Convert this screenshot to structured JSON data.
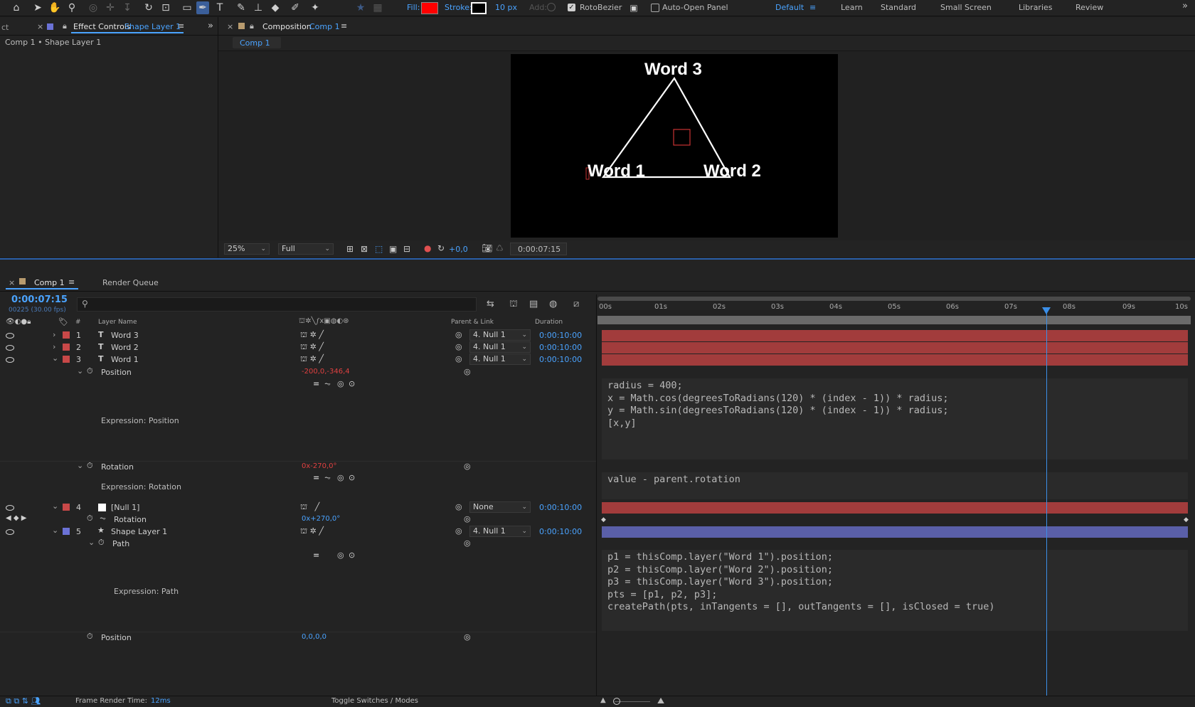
{
  "toolbar": {
    "fill_label": "Fill:",
    "fill_color": "#ff0000",
    "stroke_label": "Stroke:",
    "stroke_px": "10 px",
    "add_label": "Add:",
    "rotobezier_label": "RotoBezier",
    "autoopen_label": "Auto-Open Panel",
    "workspaces": [
      "Default",
      "Learn",
      "Standard",
      "Small Screen",
      "Libraries",
      "Review"
    ]
  },
  "left_panel": {
    "cut_tab": "ct",
    "tab_label": "Effect Controls",
    "tab_layer": "Shape Layer 1",
    "breadcrumb": "Comp 1 • Shape Layer 1"
  },
  "comp_panel": {
    "tab_label": "Composition",
    "tab_comp": "Comp 1",
    "subtab": "Comp 1",
    "zoom": "25%",
    "resolution": "Full",
    "exposure": "+0,0",
    "timecode": "0:00:07:15",
    "words": [
      "Word 3",
      "Word 1",
      "Word 2"
    ]
  },
  "timeline": {
    "tab_label": "Comp 1",
    "render_queue": "Render Queue",
    "timecode": "0:00:07:15",
    "frames": "00225 (30.00 fps)",
    "col_hash": "#",
    "col_layer_name": "Layer Name",
    "col_parent": "Parent & Link",
    "col_duration": "Duration",
    "ruler": [
      "00s",
      "01s",
      "02s",
      "03s",
      "04s",
      "05s",
      "06s",
      "07s",
      "08s",
      "09s",
      "10s"
    ],
    "playhead_fraction": 0.7583,
    "layers": [
      {
        "num": "1",
        "name": "Word 3",
        "type": "T",
        "parent": "4. Null 1",
        "duration": "0:00:10:00"
      },
      {
        "num": "2",
        "name": "Word 2",
        "type": "T",
        "parent": "4. Null 1",
        "duration": "0:00:10:00"
      },
      {
        "num": "3",
        "name": "Word 1",
        "type": "T",
        "parent": "4. Null 1",
        "duration": "0:00:10:00"
      },
      {
        "num": "4",
        "name": "[Null 1]",
        "type": "null",
        "parent": "None",
        "duration": "0:00:10:00"
      },
      {
        "num": "5",
        "name": "Shape Layer 1",
        "type": "shape",
        "parent": "4. Null 1",
        "duration": "0:00:10:00"
      }
    ],
    "props": {
      "position_label": "Position",
      "position_value": "-200,0,-346,4",
      "expr_position_label": "Expression: Position",
      "rotation_label": "Rotation",
      "rotation_value": "0x-270,0°",
      "expr_rotation_label": "Expression: Rotation",
      "null_rotation_label": "Rotation",
      "null_rotation_value": "0x+270,0°",
      "path_label": "Path",
      "expr_path_label": "Expression: Path",
      "shape_position_label": "Position",
      "shape_position_value": "0,0,0,0"
    },
    "expressions": {
      "position": "radius = 400;\nx = Math.cos(degreesToRadians(120) * (index - 1)) * radius;\ny = Math.sin(degreesToRadians(120) * (index - 1)) * radius;\n[x,y]",
      "rotation": "value - parent.rotation",
      "path": "p1 = thisComp.layer(\"Word 1\").position;\np2 = thisComp.layer(\"Word 2\").position;\np3 = thisComp.layer(\"Word 3\").position;\npts = [p1, p2, p3];\ncreatePath(pts, inTangents = [], outTangents = [], isClosed = true)"
    },
    "footer": {
      "render_label": "Frame Render Time:",
      "render_value": "12ms",
      "toggle": "Toggle Switches / Modes"
    }
  },
  "colors": {
    "accent": "#4aa3ff",
    "label_red": "#c84848",
    "label_blue": "#6b72d6",
    "bar_red": "#a23c3c",
    "bar_blue": "#5a5fa8"
  }
}
